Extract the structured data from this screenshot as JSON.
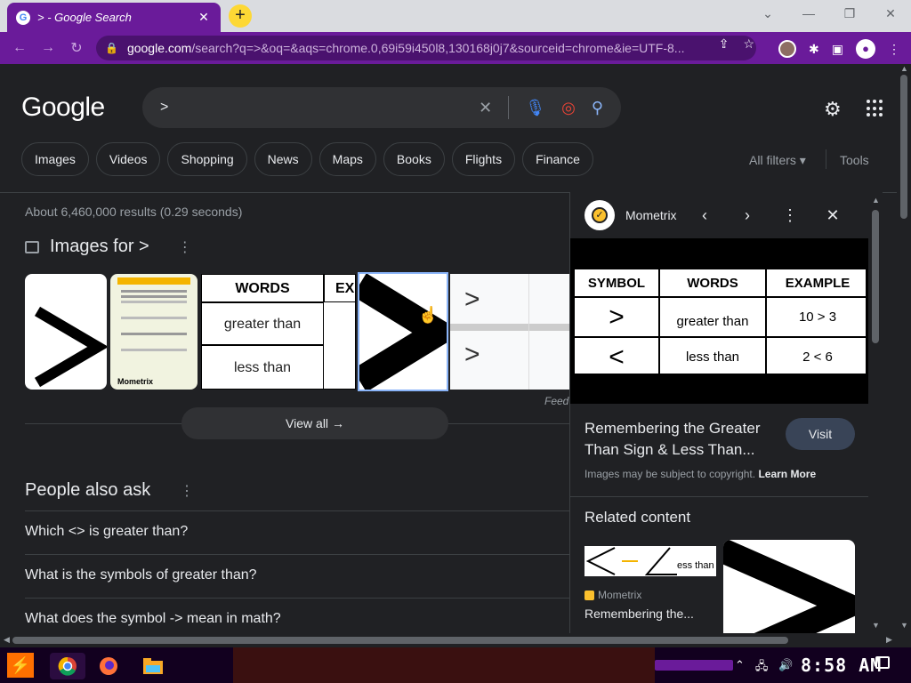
{
  "browser": {
    "tab_title": "> - Google Search",
    "tab_favicon": "G",
    "url_host": "google.com",
    "url_path": "/search?q=>&oq=&aqs=chrome.0,69i59i450l8,130168j0j7&sourceid=chrome&ie=UTF-8...",
    "accent_color": "#6a1b9a"
  },
  "google": {
    "logo": "Google",
    "query": ">",
    "chips": [
      "Images",
      "Videos",
      "Shopping",
      "News",
      "Maps",
      "Books",
      "Flights",
      "Finance"
    ],
    "all_filters": "All filters",
    "tools": "Tools",
    "stats": "About 6,460,000 results (0.29 seconds)",
    "images_for": "Images for >",
    "thumb_words_header": "WORDS",
    "thumb_ex_header": "EX",
    "thumb_greater": "greater than",
    "thumb_less": "less than",
    "feedback": "Feed",
    "view_all": "View all",
    "paa_title": "People also ask",
    "paa": [
      "Which <> is greater than?",
      "What is the symbols of greater than?",
      "What does the symbol -> mean in math?"
    ]
  },
  "panel": {
    "source": "Mometrix",
    "table": {
      "headers": [
        "SYMBOL",
        "WORDS",
        "EXAMPLE"
      ],
      "rows": [
        {
          "symbol": ">",
          "words": "greater than",
          "example": "10 > 3"
        },
        {
          "symbol": "<",
          "words": "less than",
          "example": "2 < 6"
        }
      ]
    },
    "caption": "Remembering the Greater Than Sign & Less Than...",
    "visit": "Visit",
    "copyright": "Images may be subject to copyright.",
    "learn_more": "Learn More",
    "related": "Related content",
    "related_image_text": "ess than",
    "related_source": "Mometrix",
    "related_title": "Remembering the..."
  },
  "taskbar": {
    "clock": "8:58 AM"
  }
}
